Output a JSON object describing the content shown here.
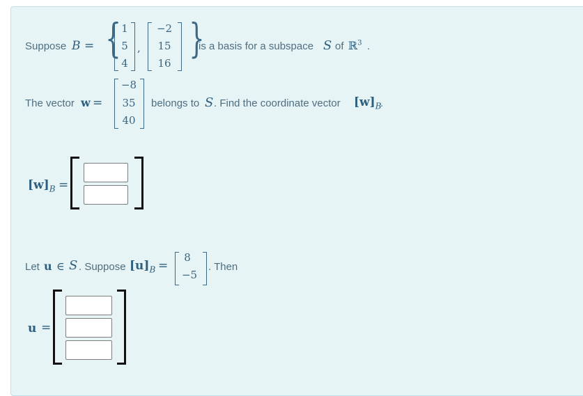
{
  "problem": {
    "line1": {
      "prefix": "Suppose",
      "basis_symbol": "B",
      "equals": "=",
      "vectors": [
        [
          "1",
          "5",
          "4"
        ],
        [
          "-2",
          "15",
          "16"
        ]
      ],
      "comma": ",",
      "suffix_a": "is a basis for a subspace",
      "subspace_symbol": "S",
      "suffix_b": "of",
      "space_symbol": "ℝ",
      "space_exponent": "3",
      "period": "."
    },
    "line2": {
      "prefix": "The vector",
      "vec_symbol": "w",
      "equals": "=",
      "vector": [
        "-8",
        "35",
        "40"
      ],
      "suffix_a": "belongs to",
      "subspace_symbol": "S",
      "suffix_b": ". Find the coordinate vector",
      "coord_label": "[w]",
      "coord_sub": "B",
      "period": "."
    },
    "answer_w": {
      "label": "[w]",
      "label_sub": "B",
      "equals": "=",
      "inputs": [
        "",
        ""
      ]
    },
    "line3": {
      "prefix": "Let",
      "vec_symbol": "u",
      "in_symbol": "∈",
      "subspace_symbol": "S",
      "mid": ". Suppose",
      "coord_label": "[u]",
      "coord_sub": "B",
      "equals": "=",
      "vector": [
        "8",
        "-5"
      ],
      "suffix": ". Then"
    },
    "answer_u": {
      "label": "u",
      "equals": "=",
      "inputs": [
        "",
        "",
        ""
      ]
    }
  }
}
